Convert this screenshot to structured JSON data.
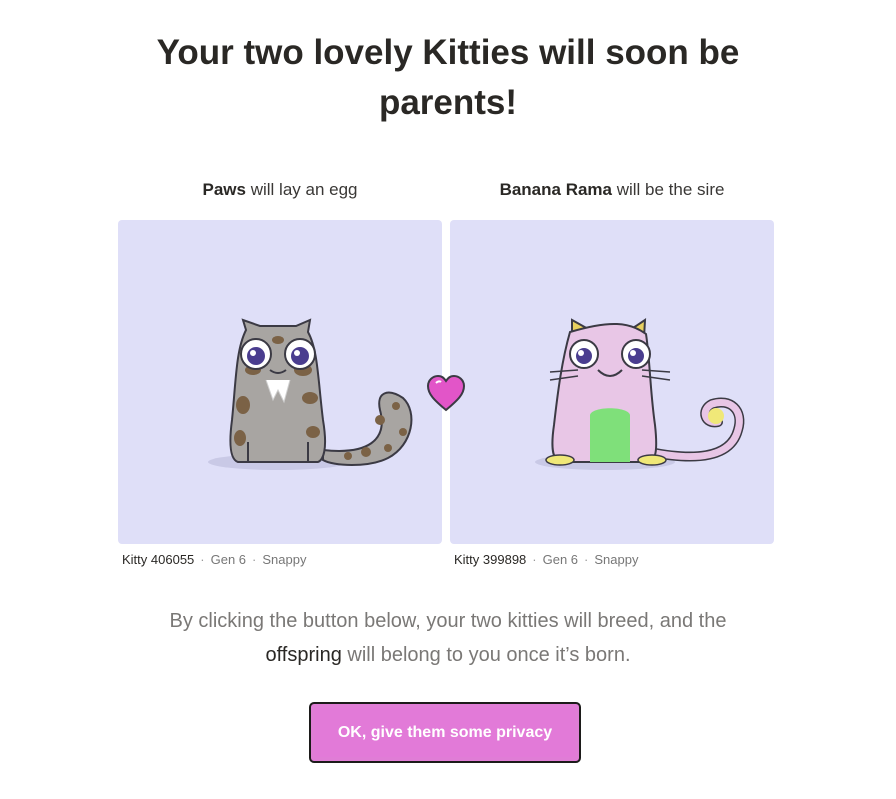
{
  "header": {
    "title_line1": "Your two lovely Kitties will soon be",
    "title_line2": "parents!"
  },
  "matron": {
    "name": "Paws",
    "role_text": " will lay an egg",
    "kitty_id": "Kitty 406055",
    "gen": "Gen 6",
    "speed": "Snappy"
  },
  "sire": {
    "name": "Banana Rama",
    "role_text": " will be the sire",
    "kitty_id": "Kitty 399898",
    "gen": "Gen 6",
    "speed": "Snappy"
  },
  "description": {
    "line1": "By clicking the button below, your two kitties will breed, and the",
    "emphasis": "offspring",
    "line2_rest": " will belong to you once it’s born."
  },
  "action": {
    "button_label": "OK, give them some privacy"
  },
  "colors": {
    "card_bg": "#dfdff8",
    "button_bg": "#e27ad8",
    "heart": "#e255c8"
  },
  "icons": {
    "heart": "heart-icon"
  }
}
